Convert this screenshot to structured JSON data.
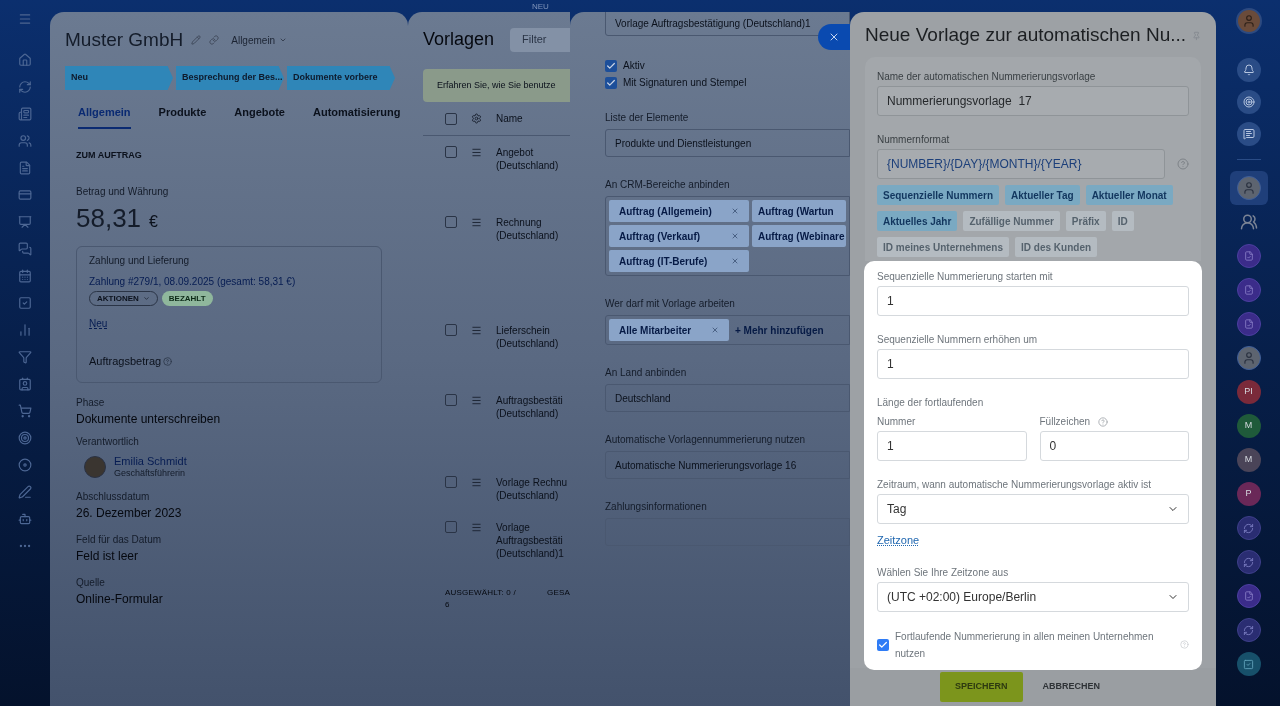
{
  "top_label": "NEU",
  "deal_panel": {
    "title": "Muster GmbH",
    "view": "Allgemein",
    "stages": [
      "Neu",
      "Besprechung der Bes...",
      "Dokumente vorbere"
    ],
    "tabs": [
      {
        "label": "Allgemein",
        "selected": true
      },
      {
        "label": "Produkte",
        "selected": false
      },
      {
        "label": "Angebote",
        "selected": false
      },
      {
        "label": "Automatisierung",
        "selected": false
      }
    ],
    "section_title": "ZUM AUFTRAG",
    "amount_label": "Betrag und Währung",
    "amount": "58,31",
    "currency": "€",
    "payment": {
      "title": "Zahlung und Lieferung",
      "link": "Zahlung #279/1, 08.09.2025 (gesamt: 58,31 €)",
      "actions": "AKTIONEN",
      "status": "BEZAHLT",
      "new_link": "Neu",
      "total_label": "Auftragsbetrag"
    },
    "fields": [
      {
        "kind": "text",
        "label": "Phase",
        "value": "Dokumente unterschreiben"
      },
      {
        "kind": "person",
        "label": "Verantwortlich",
        "value": "Emilia Schmidt",
        "role": "Geschäftsführerin"
      },
      {
        "kind": "text",
        "label": "Abschlussdatum",
        "value": "26. Dezember 2023"
      },
      {
        "kind": "text",
        "label": "Feld für das Datum",
        "value": "Feld ist leer"
      },
      {
        "kind": "text",
        "label": "Quelle",
        "value": "Online-Formular"
      }
    ]
  },
  "templates_panel": {
    "title": "Vorlagen",
    "filter_placeholder": "Filter",
    "hint": "Erfahren Sie, wie Sie benutze",
    "column": "Name",
    "header_checked": false,
    "rows": [
      {
        "lines": [
          "Angebot",
          "(Deutschland)"
        ],
        "checked": false
      },
      {
        "lines": [
          "Rechnung",
          "(Deutschland)"
        ],
        "checked": false
      },
      {
        "lines": [
          "Lieferschein",
          "(Deutschland)"
        ],
        "checked": false
      },
      {
        "lines": [
          "Auftragsbestäti",
          "(Deutschland)"
        ],
        "checked": false
      },
      {
        "lines": [
          "Vorlage Rechnu",
          "(Deutschland)"
        ],
        "checked": false
      },
      {
        "lines": [
          "Vorlage",
          "Auftragsbestäti",
          "(Deutschland)1"
        ],
        "checked": false
      }
    ],
    "footer": [
      "AUSGEWÄHLT: 0 / 6",
      "GESA"
    ]
  },
  "template_form": {
    "top_value": "Vorlage Auftragsbestätigung (Deutschland)1",
    "checkboxes": [
      {
        "label": "Aktiv",
        "checked": true
      },
      {
        "label": "Mit Signaturen und Stempel",
        "checked": true
      }
    ],
    "sections": [
      {
        "kind": "field",
        "label": "Liste der Elemente",
        "value": "Produkte und Dienstleistungen"
      },
      {
        "kind": "chips",
        "label": "An CRM-Bereiche anbinden",
        "chips": [
          "Auftrag (Allgemein)",
          "Auftrag (Wartun",
          "Auftrag (Verkauf)",
          "Auftrag (Webinare",
          "Auftrag (IT-Berufe)"
        ]
      },
      {
        "kind": "people",
        "label": "Wer darf mit Vorlage arbeiten",
        "chips": [
          "Alle Mitarbeiter"
        ],
        "add": "+ Mehr hinzufügen"
      },
      {
        "kind": "field",
        "label": "An Land anbinden",
        "value": "Deutschland"
      },
      {
        "kind": "field",
        "label": "Automatische Vorlagennummerierung nutzen",
        "value": "Automatische Nummerierungsvorlage 16"
      },
      {
        "kind": "field",
        "label": "Zahlungsinformationen"
      }
    ]
  },
  "numbering_dialog": {
    "title": "Neue Vorlage zur automatischen Nu...",
    "name_label": "Name der automatischen Nummerierungsvorlage",
    "name_value": "Nummerierungsvorlage  17",
    "format_label": "Nummernformat",
    "format_value": "{NUMBER}/{DAY}/{MONTH}/{YEAR}",
    "tokens": [
      {
        "label": "Sequenzielle Nummern",
        "active": true
      },
      {
        "label": "Aktueller Tag",
        "active": true
      },
      {
        "label": "Aktueller Monat",
        "active": true
      },
      {
        "label": "Aktuelles Jahr",
        "active": true
      },
      {
        "label": "Zufällige Nummer",
        "active": false
      },
      {
        "label": "Präfix",
        "active": false
      },
      {
        "label": "ID",
        "active": false
      },
      {
        "label": "ID meines Unternehmens",
        "active": false
      },
      {
        "label": "ID des Kunden",
        "active": false
      }
    ],
    "start_label": "Sequenzielle Nummerierung starten mit",
    "start_value": "1",
    "step_label": "Sequenzielle Nummern erhöhen um",
    "step_value": "1",
    "length_label": "Länge der fortlaufenden",
    "number_label": "Nummer",
    "number_value": "1",
    "fill_label": "Füllzeichen",
    "fill_value": "0",
    "period_label": "Zeitraum, wann automatische Nummerierungsvorlage aktiv ist",
    "period_value": "Tag",
    "timezone_link": "Zeitzone",
    "timezone_label": "Wählen Sie Ihre Zeitzone aus",
    "timezone_value": "(UTC +02:00) Europe/Berlin",
    "shared": {
      "label": "Fortlaufende Nummerierung in allen meinen Unternehmen nutzen",
      "checked": true
    },
    "save": "SPEICHERN",
    "cancel": "ABBRECHEN"
  },
  "chats": [
    {
      "kind": "photo",
      "selected": true
    },
    {
      "kind": "group",
      "selected": false
    },
    {
      "kind": "app",
      "selected": false
    },
    {
      "kind": "app",
      "selected": false
    },
    {
      "kind": "app",
      "selected": false
    },
    {
      "kind": "photo",
      "selected": false
    },
    {
      "kind": "initials",
      "text": "PI",
      "color": "#7a2a3a",
      "selected": false
    },
    {
      "kind": "initials",
      "text": "M",
      "color": "#1f5a3a",
      "selected": false
    },
    {
      "kind": "initials",
      "text": "M",
      "color": "#4a4458",
      "selected": false
    },
    {
      "kind": "initials",
      "text": "P",
      "color": "#6a2858",
      "selected": false
    },
    {
      "kind": "channel",
      "selected": false
    },
    {
      "kind": "channel",
      "selected": false
    },
    {
      "kind": "app",
      "selected": false
    },
    {
      "kind": "channel",
      "selected": false
    },
    {
      "kind": "task",
      "selected": false
    }
  ]
}
